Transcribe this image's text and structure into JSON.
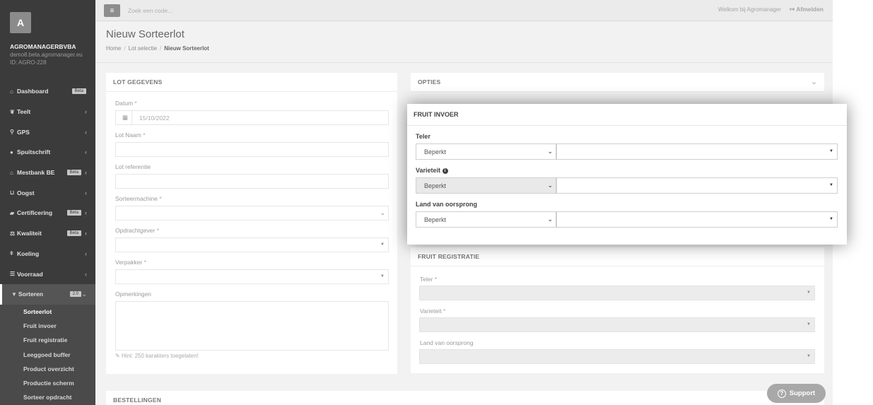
{
  "sidebar": {
    "avatar_letter": "A",
    "company": "AGROMANAGERBVBA",
    "domain": "demo8.beta.agromanager.eu",
    "org_id": "ID: AGRO-228",
    "items": [
      {
        "label": "Dashboard",
        "icon": "home-icon",
        "badge": "Beta"
      },
      {
        "label": "Teelt",
        "icon": "leaf-icon"
      },
      {
        "label": "GPS",
        "icon": "map-marker-icon"
      },
      {
        "label": "Spuitschrift",
        "icon": "drop-icon"
      },
      {
        "label": "Mestbank BE",
        "icon": "bank-icon",
        "badge": "Beta"
      },
      {
        "label": "Oogst",
        "icon": "basket-icon"
      },
      {
        "label": "Certificering",
        "icon": "certificate-icon",
        "badge": "Beta"
      },
      {
        "label": "Kwaliteit",
        "icon": "balance-icon",
        "badge": "Beta"
      },
      {
        "label": "Koeling",
        "icon": "thermometer-icon"
      },
      {
        "label": "Voorraad",
        "icon": "list-icon"
      },
      {
        "label": "Sorteren",
        "icon": "filter-icon",
        "badge": "2.0"
      }
    ],
    "sub_items": [
      "Sorteerlot",
      "Fruit invoer",
      "Fruit registratie",
      "Leeggoed buffer",
      "Product overzicht",
      "Productie scherm",
      "Sorteer opdracht"
    ]
  },
  "topbar": {
    "search_placeholder": "Zoek een code...",
    "welcome": "Welkom bij Agromanager",
    "logout": "Afmelden"
  },
  "page": {
    "title": "Nieuw Sorteerlot",
    "breadcrumb": [
      "Home",
      "Lot selectie",
      "Nieuw Sorteerlot"
    ]
  },
  "lot": {
    "header": "LOT GEGEVENS",
    "datum_label": "Datum",
    "datum_value": "15/10/2022",
    "lotnaam_label": "Lot Naam",
    "lotref_label": "Lot referentie",
    "sorteermachine_label": "Sorteermachine",
    "opdrachtgever_label": "Opdrachtgever",
    "verpakker_label": "Verpakker",
    "opmerkingen_label": "Opmerkingen",
    "hint": "Hint: 250 karakters toegelaten!",
    "required_mark": "*"
  },
  "opties": {
    "header": "OPTIES"
  },
  "registratie": {
    "header": "FRUIT REGISTRATIE",
    "teler_label": "Teler",
    "varieteit_label": "Varieteit",
    "land_label": "Land van oorsprong"
  },
  "bestellingen": {
    "header": "BESTELLINGEN"
  },
  "modal": {
    "header": "FRUIT INVOER",
    "teler_label": "Teler",
    "teler_value": "Beperkt",
    "varieteit_label": "Varieteit",
    "varieteit_value": "Beperkt",
    "land_label": "Land van oorsprong",
    "land_value": "Beperkt"
  },
  "support": {
    "label": "Support"
  }
}
